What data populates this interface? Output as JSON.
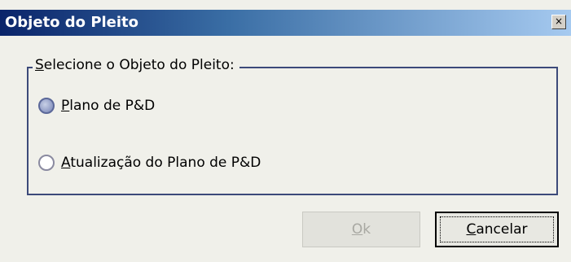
{
  "window": {
    "title": "Objeto do Pleito",
    "close_glyph": "×",
    "titlebar_color": "#0a246a"
  },
  "group": {
    "legend_accel": "S",
    "legend_rest": "elecione o Objeto do Pleito:"
  },
  "options": [
    {
      "accel": "P",
      "rest": "lano de P&D",
      "selected": true
    },
    {
      "accel": "A",
      "rest": "tualização do Plano de P&D",
      "selected": false
    }
  ],
  "buttons": {
    "ok_accel": "O",
    "ok_rest": "k",
    "ok_enabled": false,
    "cancel_accel": "C",
    "cancel_rest": "ancelar"
  }
}
